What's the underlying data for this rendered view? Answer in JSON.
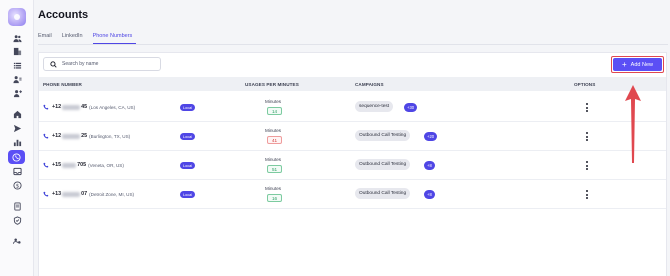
{
  "page": {
    "title": "Accounts"
  },
  "tabs": [
    {
      "label": "Email",
      "active": false
    },
    {
      "label": "LinkedIn",
      "active": false
    },
    {
      "label": "Phone Numbers",
      "active": true
    }
  ],
  "search": {
    "placeholder": "Search by name"
  },
  "add_button": {
    "label": "Add New"
  },
  "table": {
    "headers": {
      "phone": "PHONE NUMBER",
      "usages": "USAGES PER MINUTES",
      "campaigns": "CAMPAIGNS",
      "options": "OPTIONS"
    },
    "rows": [
      {
        "prefix": "+12",
        "suffix": "45",
        "location": "(Los Angeles, CA, US)",
        "type": "Local",
        "usage_label": "Minutes",
        "usage": "14",
        "usage_status": "ok",
        "campaign": "sequence-test",
        "more": "+30"
      },
      {
        "prefix": "+12",
        "suffix": "25",
        "location": "(Burlington, TX, US)",
        "type": "Local",
        "usage_label": "Minutes",
        "usage": "41",
        "usage_status": "bad",
        "campaign": "Outbound Call Testing",
        "more": "+20"
      },
      {
        "prefix": "+15",
        "suffix": "705",
        "location": "(Veneta, OR, US)",
        "type": "Local",
        "usage_label": "Minutes",
        "usage": "51",
        "usage_status": "ok",
        "campaign": "Outbound Call Testing",
        "more": "+8"
      },
      {
        "prefix": "+13",
        "suffix": "07",
        "location": "(Detroit Zone, MI, US)",
        "type": "Local",
        "usage_label": "Minutes",
        "usage": "16",
        "usage_status": "ok",
        "campaign": "Outbound Call Testing",
        "more": "+8"
      }
    ]
  },
  "sidebar": {
    "icons": [
      "people-icon",
      "building-icon",
      "list-icon",
      "contacts-icon",
      "add-user-icon",
      "home-icon",
      "send-icon",
      "chart-icon",
      "phone-circle-icon",
      "inbox-icon",
      "dollar-icon",
      "document-icon",
      "shield-icon",
      "team-icon"
    ],
    "active_icon": "phone-circle-icon"
  },
  "colors": {
    "accent": "#4f46e5",
    "button": "#5b4ff5",
    "highlight": "#e0484f"
  }
}
